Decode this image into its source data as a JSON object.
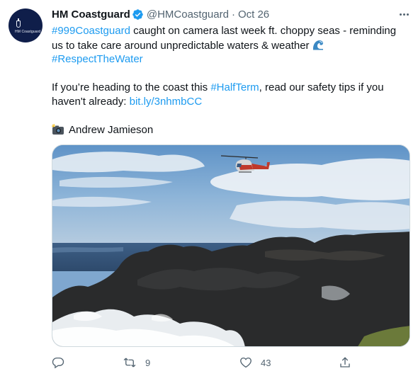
{
  "account": {
    "name": "HM Coastguard",
    "handle": "@HMCoastguard",
    "separator": "·",
    "date": "Oct 26",
    "avatar_text": "HM Coastguard"
  },
  "tweet": {
    "line1_link": "#999Coastguard",
    "line1_text": " caught on camera last week ft. choppy seas - reminding",
    "line2_text": "us to take care around unpredictable waters & weather",
    "line2_emoji": "water-wave-emoji",
    "line3_link": "#RespectTheWater",
    "line4_text_a": "If you’re heading to the coast this ",
    "line4_link": "#HalfTerm",
    "line4_text_b": ", read our safety tips if you",
    "line5_text": "haven't already: ",
    "line5_link": "bit.ly/3nhmbCC",
    "photo_credit_emoji": "camera-with-flash-emoji",
    "photo_credit": "Andrew Jamieson"
  },
  "media": {
    "description_icon": "coastguard-helicopter-over-rocky-coast-photo"
  },
  "actions": {
    "reply_icon": "reply-icon",
    "retweet_icon": "retweet-icon",
    "retweet_count": "9",
    "like_icon": "heart-icon",
    "like_count": "43",
    "share_icon": "share-icon"
  },
  "colors": {
    "link": "#1d9bf0",
    "verified": "#1d9bf0",
    "secondary_text": "#536471",
    "primary_text": "#0f1419",
    "avatar_bg": "#0f1e4a"
  }
}
